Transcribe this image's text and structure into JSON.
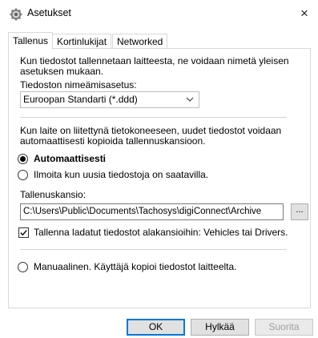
{
  "window": {
    "title": "Asetukset",
    "close_glyph": "×",
    "icon": "gear-icon"
  },
  "tabs": [
    {
      "label": "Tallenus",
      "active": true
    },
    {
      "label": "Kortinlukijat",
      "active": false
    },
    {
      "label": "Networked Devices",
      "active": false
    }
  ],
  "naming": {
    "intro_line1": "Kun tiedostot tallennetaan laitteesta, ne voidaan nimetä yleisen",
    "intro_line2": "asetuksen mukaan.",
    "label": "Tiedoston nimeämisasetus:",
    "selected": "Euroopan Standarti (*.ddd)"
  },
  "auto": {
    "intro_line1": "Kun laite on liitettynä tietokoneeseen, uudet tiedostot voidaan",
    "intro_line2": "automaattisesti kopioida tallennuskansioon.",
    "option_auto": "Automaattisesti",
    "option_notify": "Ilmoita kun uusia tiedostoja on saatavilla.",
    "folder_label": "Tallenuskansio:",
    "folder_path": "C:\\Users\\Public\\Documents\\Tachosys\\digiConnect\\Archive",
    "browse_label": "...",
    "subfolder_checkbox": "Tallenna ladatut tiedostot alakansioihin: Vehicles tai Drivers.",
    "subfolder_checked": true
  },
  "manual": {
    "option_manual": "Manuaalinen. Käyttäjä kopioi tiedostot laitteelta."
  },
  "buttons": {
    "ok": "OK",
    "cancel": "Hylkää",
    "apply": "Suorita"
  },
  "selected_radio": "auto"
}
